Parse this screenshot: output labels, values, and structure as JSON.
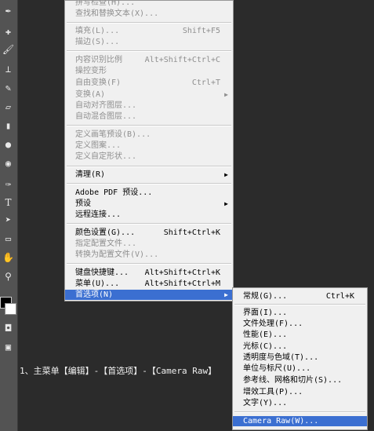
{
  "menu": {
    "items": [
      {
        "label": "拼写检查(H)...",
        "shortcut": "",
        "disabled": true
      },
      {
        "label": "查找和替换文本(X)...",
        "shortcut": "",
        "disabled": true
      },
      {
        "label": "填充(L)...",
        "shortcut": "Shift+F5",
        "disabled": true
      },
      {
        "label": "描边(S)...",
        "shortcut": "",
        "disabled": true
      },
      {
        "label": "内容识别比例",
        "shortcut": "Alt+Shift+Ctrl+C",
        "disabled": true
      },
      {
        "label": "操控变形",
        "shortcut": "",
        "disabled": true
      },
      {
        "label": "自由变换(F)",
        "shortcut": "Ctrl+T",
        "disabled": true
      },
      {
        "label": "变换(A)",
        "shortcut": "",
        "disabled": true
      },
      {
        "label": "自动对齐图层...",
        "shortcut": "",
        "disabled": true
      },
      {
        "label": "自动混合图层...",
        "shortcut": "",
        "disabled": true
      },
      {
        "label": "定义画笔预设(B)...",
        "shortcut": "",
        "disabled": true
      },
      {
        "label": "定义图案...",
        "shortcut": "",
        "disabled": true
      },
      {
        "label": "定义自定形状...",
        "shortcut": "",
        "disabled": true
      },
      {
        "label": "清理(R)",
        "shortcut": "",
        "disabled": false
      },
      {
        "label": "Adobe PDF 预设...",
        "shortcut": "",
        "disabled": false
      },
      {
        "label": "预设",
        "shortcut": "",
        "disabled": false
      },
      {
        "label": "远程连接...",
        "shortcut": "",
        "disabled": false
      },
      {
        "label": "颜色设置(G)...",
        "shortcut": "Shift+Ctrl+K",
        "disabled": false
      },
      {
        "label": "指定配置文件...",
        "shortcut": "",
        "disabled": true
      },
      {
        "label": "转换为配置文件(V)...",
        "shortcut": "",
        "disabled": true
      },
      {
        "label": "键盘快捷键...",
        "shortcut": "Alt+Shift+Ctrl+K",
        "disabled": false
      },
      {
        "label": "菜单(U)...",
        "shortcut": "Alt+Shift+Ctrl+M",
        "disabled": false
      },
      {
        "label": "首选项(N)",
        "shortcut": "",
        "disabled": false
      }
    ]
  },
  "submenu": {
    "items": [
      {
        "label": "常规(G)...",
        "shortcut": "Ctrl+K"
      },
      {
        "label": "界面(I)..."
      },
      {
        "label": "文件处理(F)..."
      },
      {
        "label": "性能(E)..."
      },
      {
        "label": "光标(C)..."
      },
      {
        "label": "透明度与色域(T)..."
      },
      {
        "label": "单位与标尺(U)..."
      },
      {
        "label": "参考线、网格和切片(S)..."
      },
      {
        "label": "增效工具(P)..."
      },
      {
        "label": "文字(Y)..."
      },
      {
        "label": "Camera Raw(W)..."
      }
    ]
  },
  "caption": "1、主菜单【编辑】-【首选项】-【Camera Raw】",
  "tools": {
    "icons": [
      "eyedropper-icon",
      "healing-brush-icon",
      "brush-icon",
      "clone-stamp-icon",
      "history-brush-icon",
      "eraser-icon",
      "gradient-icon",
      "blur-icon",
      "dodge-icon",
      "pen-icon",
      "type-icon",
      "path-select-icon",
      "shape-icon",
      "hand-icon",
      "zoom-icon"
    ],
    "glyphs": [
      "✒",
      "✚",
      "🖌",
      "⊥",
      "✎",
      "▱",
      "▮",
      "●",
      "◉",
      "✑",
      "T",
      "➤",
      "▭",
      "✋",
      "⚲"
    ],
    "quickmask_glyph": "◘",
    "screenmode_glyph": "▣"
  },
  "colors": {
    "highlight": "#3b6fd1",
    "menu_bg": "#f0f0f0",
    "disabled_text": "#8e8e8e"
  }
}
